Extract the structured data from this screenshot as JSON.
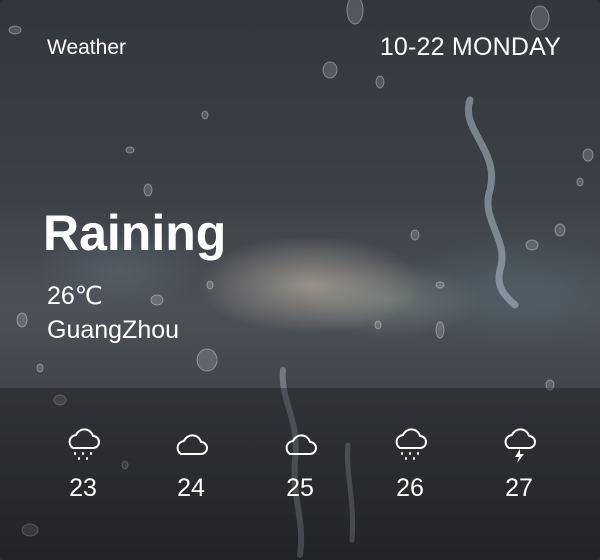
{
  "widget": {
    "title": "Weather",
    "date": "10-22 MONDAY",
    "condition": "Raining",
    "temperature": "26℃",
    "city": "GuangZhou"
  },
  "forecast": [
    {
      "day": "23",
      "icon": "rain-cloud-icon"
    },
    {
      "day": "24",
      "icon": "cloud-icon"
    },
    {
      "day": "25",
      "icon": "cloud-icon"
    },
    {
      "day": "26",
      "icon": "rain-cloud-icon"
    },
    {
      "day": "27",
      "icon": "thunderstorm-icon"
    }
  ],
  "colors": {
    "text": "#ffffff",
    "background": "#3c4148"
  }
}
